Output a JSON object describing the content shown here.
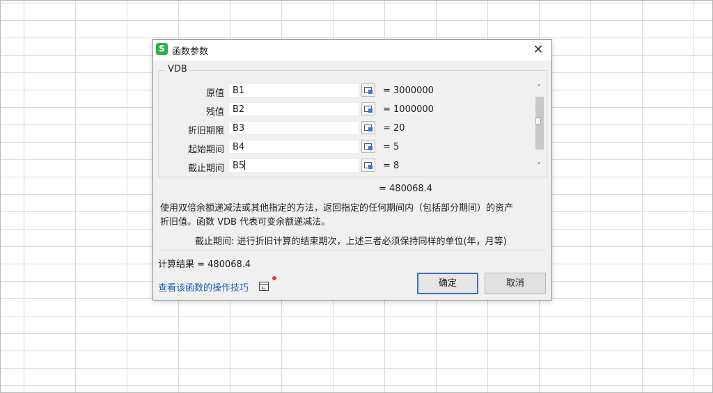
{
  "dialog": {
    "title": "函数参数",
    "app_icon": "S",
    "close_glyph": "✕",
    "function_name": "VDB",
    "params": [
      {
        "label": "原值",
        "input": "B1",
        "value": "= 3000000"
      },
      {
        "label": "残值",
        "input": "B2",
        "value": "= 1000000"
      },
      {
        "label": "折旧期限",
        "input": "B3",
        "value": "= 20"
      },
      {
        "label": "起始期间",
        "input": "B4",
        "value": "= 5"
      },
      {
        "label": "截止期间",
        "input": "B5",
        "value": "= 8"
      }
    ],
    "scroll_up_glyph": "˄",
    "scroll_down_glyph": "˅",
    "formula_result": "= 480068.4",
    "description_line1": "使用双倍余额递减法或其他指定的方法，返回指定的任何期间内（包括部分期间）的资产",
    "description_line2": "折旧值。函数 VDB 代表可变余额递减法。",
    "param_description": "截止期间:  进行折旧计算的结束期次，上述三者必须保持同样的单位(年，月等)",
    "calc_result": "计算结果 = 480068.4",
    "help_link": "查看该函数的操作技巧",
    "ok_label": "确定",
    "cancel_label": "取消"
  },
  "colors": {
    "accent": "#3a6fc0",
    "link": "#1c5fbf",
    "app_icon_bg": "#2bb24c",
    "notification_dot": "#e53935"
  },
  "icons": [
    "close-icon",
    "range-select-icon",
    "help-window-icon",
    "app-icon"
  ]
}
